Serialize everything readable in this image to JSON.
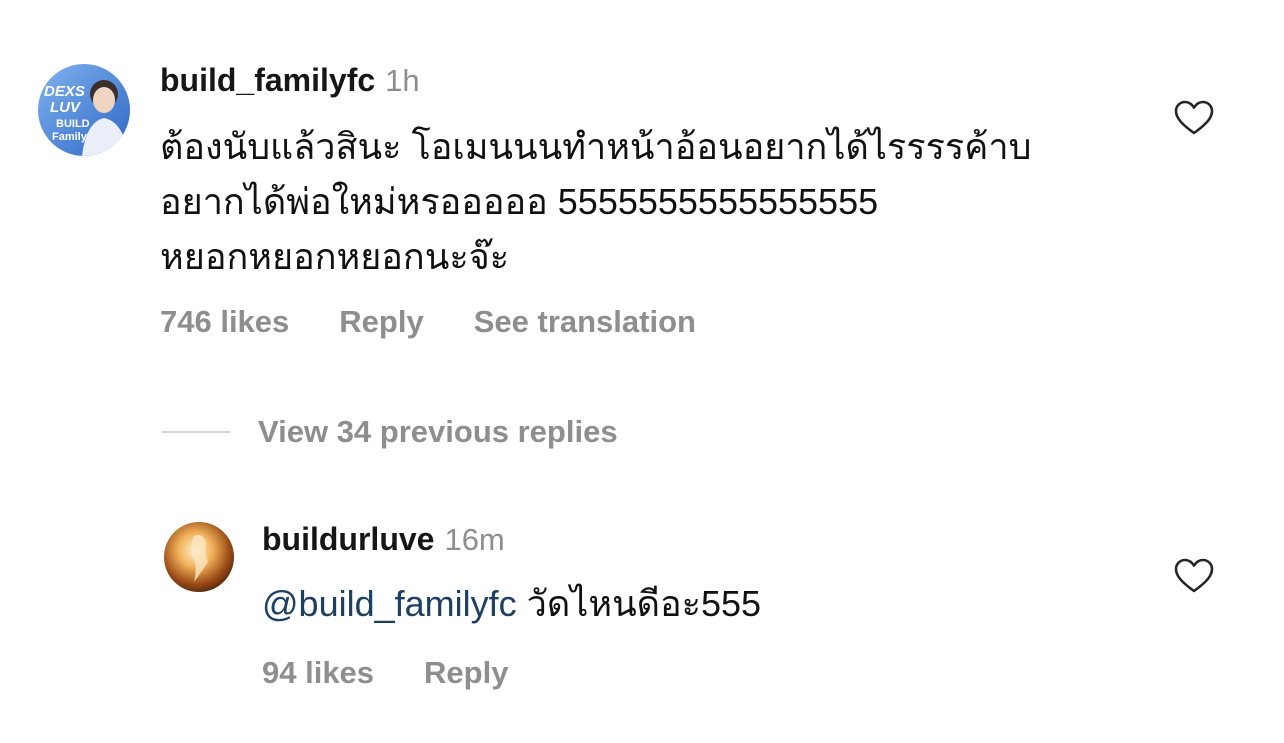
{
  "comment": {
    "username": "build_familyfc",
    "time": "1h",
    "avatar_text": [
      "DEXS",
      "LUV",
      "BUILD",
      "Family"
    ],
    "lines": [
      "ต้องนับแล้วสินะ โอเมนนนทำหน้าอ้อนอยากได้ไรรรรค้าบ",
      "อยากได้พ่อใหม่หรอออออ 5555555555555555",
      "หยอกหยอกหยอกนะจ๊ะ"
    ],
    "likes": "746 likes",
    "reply": "Reply",
    "see_translation": "See translation"
  },
  "view_previous_replies": "View 34 previous replies",
  "reply_comment": {
    "username": "buildurluve",
    "time": "16m",
    "mention": "@build_familyfc",
    "text": " วัดไหนดีอะ555",
    "likes": "94 likes",
    "reply": "Reply"
  },
  "colors": {
    "text": "#111111",
    "secondary": "#8e8e8e",
    "mention": "#1c3f66"
  }
}
